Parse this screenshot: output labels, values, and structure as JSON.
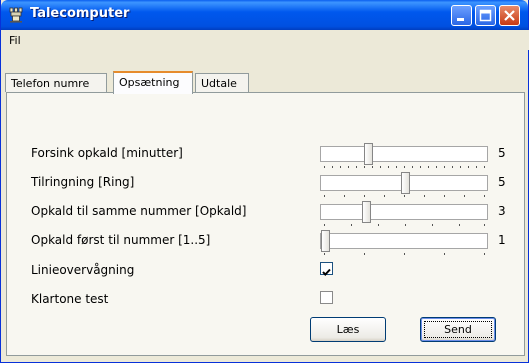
{
  "window": {
    "title": "Talecomputer"
  },
  "menu": {
    "items": [
      "Fil"
    ]
  },
  "tabs": [
    {
      "label": "Telefon numre"
    },
    {
      "label": "Opsætning"
    },
    {
      "label": "Udtale"
    }
  ],
  "active_tab": "Opsætning",
  "settings": {
    "rows": [
      {
        "label": "Forsink opkald [minutter]",
        "value": "5",
        "level": 0.25
      },
      {
        "label": "Tilringning [Ring]",
        "value": "5",
        "level": 0.5
      },
      {
        "label": "Opkald til samme nummer [Opkald]",
        "value": "3",
        "level": 0.25
      },
      {
        "label": "Opkald først til nummer [1..5]",
        "value": "1",
        "level": 0.0
      }
    ],
    "checks": [
      {
        "label": "Linieovervågning",
        "checked": true
      },
      {
        "label": "Klartone test",
        "checked": false
      }
    ]
  },
  "buttons": {
    "read": "Læs",
    "send": "Send"
  }
}
